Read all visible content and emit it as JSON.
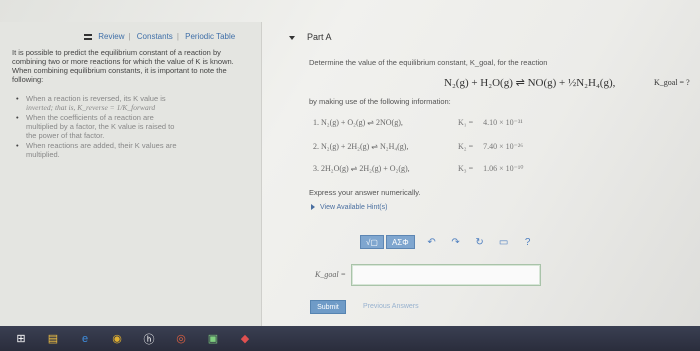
{
  "left_panel": {
    "tabs": [
      "Review",
      "Constants",
      "Periodic Table"
    ],
    "intro": "It is possible to predict the equilibrium constant of a reaction by combining two or more reactions for which the value of K is known. When combining equilibrium constants, it is important to note the following:",
    "bullets": [
      {
        "line1": "When a reaction is reversed, its K value is",
        "line2": "inverted; that is, K_reverse = 1/K_forward"
      },
      {
        "line1": "When the coefficients of a reaction are",
        "line2": "multiplied by a factor, the K value is raised to",
        "line3": "the power of that factor."
      },
      {
        "line1": "When reactions are added, their K values are",
        "line2": "multiplied."
      }
    ]
  },
  "part": {
    "title": "Part A",
    "question": "Determine the value of the equilibrium constant, K_goal, for the reaction",
    "goal_equation": "N₂(g) + H₂O(g) ⇌ NO(g) + ½N₂H₄(g),",
    "goal_k": "K_goal = ?",
    "using": "by making use of the following information:",
    "reactions": [
      {
        "num": "1.",
        "eq": "N₂(g) + O₂(g) ⇌ 2NO(g),",
        "k_label": "K₁ =",
        "k_value": "4.10 × 10⁻³¹"
      },
      {
        "num": "2.",
        "eq": "N₂(g) + 2H₂(g) ⇌ N₂H₄(g),",
        "k_label": "K₂ =",
        "k_value": "7.40 × 10⁻²⁶"
      },
      {
        "num": "3.",
        "eq": "2H₂O(g) ⇌ 2H₂(g) + O₂(g),",
        "k_label": "K₃ =",
        "k_value": "1.06 × 10⁻¹⁰"
      }
    ],
    "express": "Express your answer numerically.",
    "hints": "View Available Hint(s)",
    "toolbar": {
      "templates": "√▢",
      "symbols": "ΑΣΦ"
    },
    "answer_label": "K_goal =",
    "answer_value": "",
    "submit": "Submit",
    "previous": "Previous Answers"
  },
  "colors": {
    "link": "#3f6fa8",
    "button": "#6f9bc7",
    "taskbar": "#2a2d3c"
  },
  "taskbar_icons": [
    "windows-logo-icon",
    "file-explorer-icon",
    "edge-icon",
    "chrome-icon",
    "hp-icon",
    "camera-icon",
    "store-icon",
    "app-icon"
  ]
}
